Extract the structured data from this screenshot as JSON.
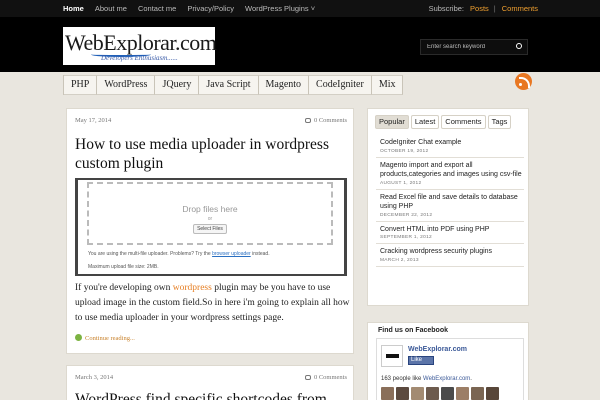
{
  "topnav": {
    "items": [
      "Home",
      "About me",
      "Contact me",
      "Privacy/Policy",
      "WordPress Plugins ˅"
    ],
    "subscribe_label": "Subscribe:",
    "posts": "Posts",
    "divider": "|",
    "comments": "Comments"
  },
  "header": {
    "logo_text": "WebExplorar.com",
    "logo_tagline": "Developers Enthusiasm......",
    "search_placeholder": "Enter search keyword"
  },
  "categories": [
    "PHP",
    "WordPress",
    "JQuery",
    "Java Script",
    "Magento",
    "CodeIgniter",
    "Mix"
  ],
  "posts": [
    {
      "date": "May 17, 2014",
      "comments": "0 Comments",
      "title": "How to use media uploader in wordpress custom plugin",
      "screenshot": {
        "drop_title": "Drop files here",
        "or": "or",
        "select_button": "Select Files",
        "note_before": "You are using the multi-file uploader. Problems? Try the ",
        "note_link": "browser uploader",
        "note_after": " instead.",
        "max_size": "Maximum upload file size: 2MB."
      },
      "excerpt_before": "If you're developing own ",
      "excerpt_keyword": "wordpress",
      "excerpt_after": " plugin may be you have to use upload image in the custom field.So in here i'm going to explain all how to use media uploader in your wordpress settings page.",
      "continue": "Continue reading..."
    },
    {
      "date": "March 3, 2014",
      "comments": "0 Comments",
      "title": "WordPress find specific shortcodes from"
    }
  ],
  "sidebar": {
    "tabs": [
      "Popular",
      "Latest",
      "Comments",
      "Tags"
    ],
    "active_tab": "Popular",
    "recent": [
      {
        "title": "CodeIgniter Chat example",
        "date": "OCTOBER 19, 2012"
      },
      {
        "title": "Magento import and export all products,categories and images using csv-file",
        "date": "AUGUST 1, 2012"
      },
      {
        "title": "Read Excel file and save details to database using PHP",
        "date": "DECEMBER 22, 2012"
      },
      {
        "title": "Convert HTML into PDF using PHP",
        "date": "SEPTEMBER 1, 2012"
      },
      {
        "title": "Cracking wordpress security plugins",
        "date": "MARCH 2, 2013"
      }
    ]
  },
  "facebook": {
    "title": "Find us on Facebook",
    "page_name": "WebExplorar.com",
    "like_label": "Like",
    "count_before": "163 people like ",
    "count_link": "WebExplorar.com",
    "count_after": "."
  },
  "colors": {
    "accent_orange": "#f0a030",
    "link_blue": "#2a6fc1",
    "facebook_blue": "#3b5998",
    "rss_orange": "#e87722"
  }
}
